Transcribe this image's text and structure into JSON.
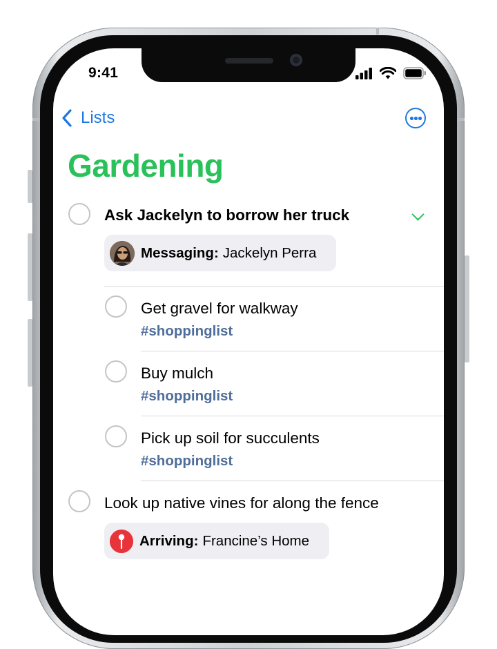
{
  "status_bar": {
    "time": "9:41"
  },
  "nav": {
    "back_label": "Lists"
  },
  "list": {
    "title": "Gardening",
    "title_color": "#2ac15a",
    "accent_color": "#1e78e0",
    "tag_color": "#4f6e9b"
  },
  "reminders": [
    {
      "title": "Ask Jackelyn to borrow her truck",
      "chip": {
        "icon": "contact-avatar-icon",
        "label": "Messaging:",
        "value": "Jackelyn Perra"
      },
      "expanded": true,
      "subtasks": [
        {
          "title": "Get gravel for walkway",
          "tag": "#shoppinglist"
        },
        {
          "title": "Buy mulch",
          "tag": "#shoppinglist"
        },
        {
          "title": "Pick up soil for succulents",
          "tag": "#shoppinglist"
        }
      ]
    },
    {
      "title": "Look up native vines for along the fence",
      "chip": {
        "icon": "location-pin-icon",
        "label": "Arriving:",
        "value": "Francine’s Home"
      }
    }
  ]
}
